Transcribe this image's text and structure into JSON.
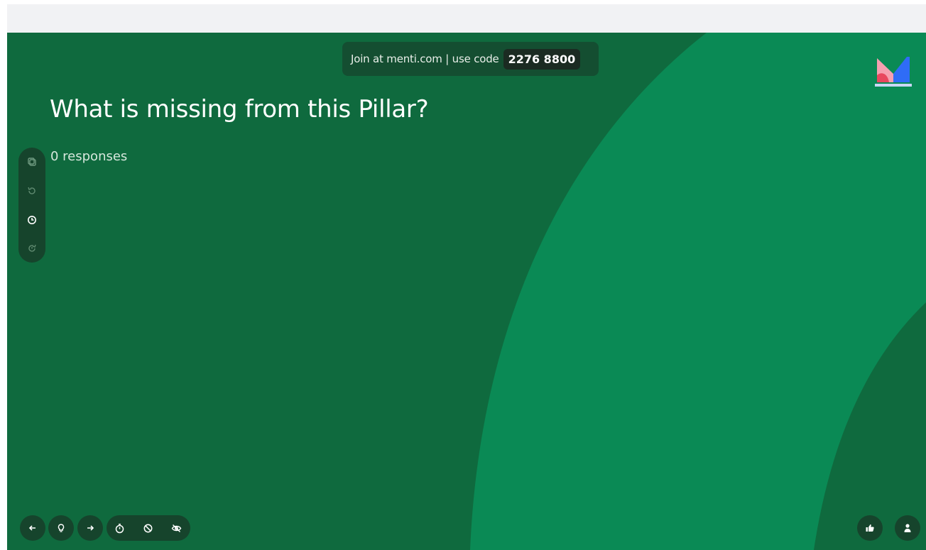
{
  "join_bar": {
    "prefix_text": "Join at menti.com | use code",
    "code": "2276 8800"
  },
  "slide": {
    "question": "What is missing from this Pillar?",
    "response_count_text": "0 responses"
  },
  "colors": {
    "slide_background": "#0f6a3e",
    "arc_light": "#0a8a55",
    "arc_dark": "#0f6a3e",
    "toolbar_bg": "#16442c"
  },
  "side_toolbar": {
    "icons": [
      "copy-icon",
      "reset-results-icon",
      "timer-icon",
      "history-icon"
    ]
  },
  "bottom_toolbar": {
    "icons": [
      "arrow-left-icon",
      "lightbulb-icon",
      "arrow-right-icon",
      "stopwatch-icon",
      "block-icon",
      "hide-icon"
    ]
  },
  "bottom_right": {
    "icons": [
      "thumbs-up-icon",
      "person-icon"
    ]
  }
}
